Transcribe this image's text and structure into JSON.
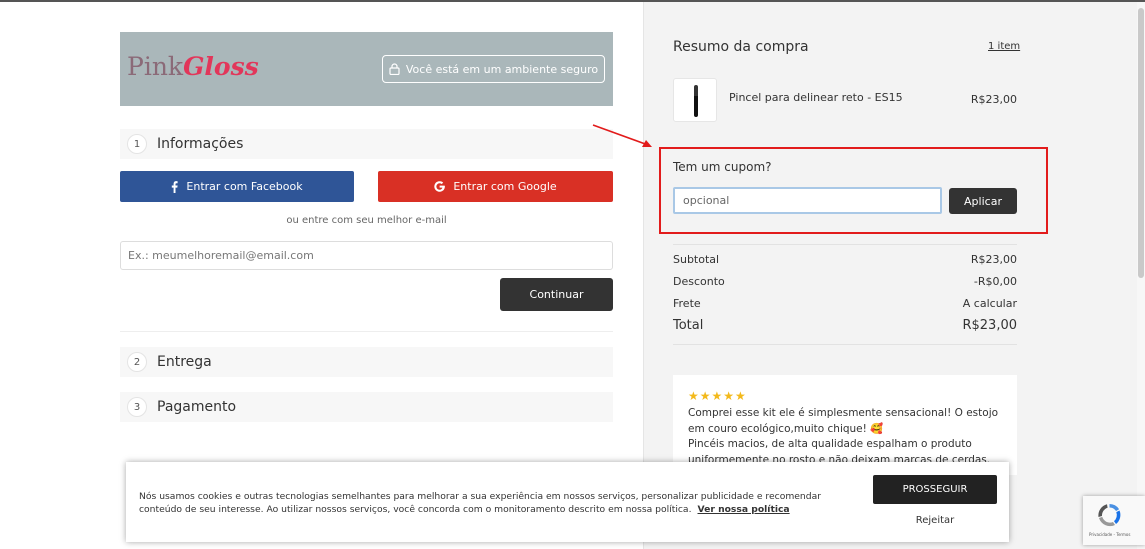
{
  "header": {
    "logo_pink": "Pink",
    "logo_gloss": "Gloss",
    "secure_label": "Você está em um ambiente seguro"
  },
  "steps": [
    {
      "num": "1",
      "label": "Informações"
    },
    {
      "num": "2",
      "label": "Entrega"
    },
    {
      "num": "3",
      "label": "Pagamento"
    }
  ],
  "login": {
    "facebook_label": "Entrar com Facebook",
    "google_label": "Entrar com Google",
    "or_text": "ou entre com seu melhor e-mail",
    "email_placeholder": "Ex.: meumelhoremail@email.com",
    "continue_label": "Continuar"
  },
  "summary": {
    "title": "Resumo da compra",
    "items_link": "1 item",
    "product_name": "Pincel para delinear reto - ES15",
    "product_price": "R$23,00"
  },
  "coupon": {
    "title": "Tem um cupom?",
    "input_value": "opcional",
    "apply_label": "Aplicar"
  },
  "totals": {
    "subtotal_label": "Subtotal",
    "subtotal_value": "R$23,00",
    "discount_label": "Desconto",
    "discount_value": "-R$0,00",
    "shipping_label": "Frete",
    "shipping_value": "A calcular",
    "total_label": "Total",
    "total_value": "R$23,00"
  },
  "review": {
    "stars": "★★★★★",
    "line1": "Comprei esse kit ele é simplesmente sensacional! O estojo em couro ecológico,muito chique! 🥰",
    "line2": "Pincéis macios, de alta qualidade espalham o produto uniformemente no rosto e não deixam marcas de cerdas. Mais"
  },
  "cookie": {
    "text": "Nós usamos cookies e outras tecnologias semelhantes para melhorar a sua experiência em nossos serviços, personalizar publicidade e recomendar conteúdo de seu interesse. Ao utilizar nossos serviços, você concorda com o monitoramento descrito em nossa política.",
    "policy_link": "Ver nossa política",
    "accept_label": "PROSSEGUIR",
    "reject_label": "Rejeitar"
  },
  "recaptcha": {
    "text": "Privacidade - Termos"
  },
  "colors": {
    "facebook": "#2f5597",
    "google": "#d93025",
    "highlight_box": "#e21b1b",
    "dark_button": "#333333",
    "header_bg": "#aab7ba",
    "logo_accent": "#e2365a"
  }
}
